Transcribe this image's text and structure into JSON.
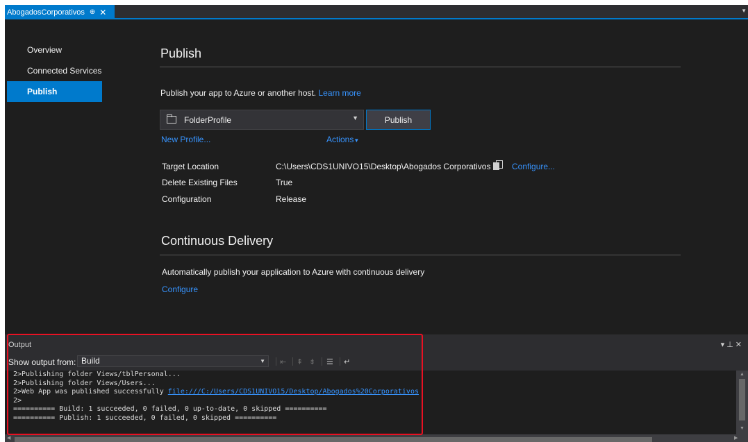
{
  "tab": {
    "title": "AbogadosCorporativos",
    "pin_glyph": "⊕",
    "close_glyph": "✕"
  },
  "nav": {
    "items": [
      {
        "label": "Overview"
      },
      {
        "label": "Connected Services"
      },
      {
        "label": "Publish",
        "active": true
      }
    ]
  },
  "publish": {
    "title": "Publish",
    "intro_text": "Publish your app to Azure or another host.",
    "learn_more": "Learn more",
    "profile_selected": "FolderProfile",
    "publish_button": "Publish",
    "new_profile": "New Profile...",
    "actions": "Actions",
    "details": [
      {
        "key": "Target Location",
        "value": "C:\\Users\\CDS1UNIVO15\\Desktop\\Abogados Corporativos"
      },
      {
        "key": "Delete Existing Files",
        "value": "True"
      },
      {
        "key": "Configuration",
        "value": "Release"
      }
    ],
    "configure": "Configure..."
  },
  "continuous_delivery": {
    "title": "Continuous Delivery",
    "description": "Automatically publish your application to Azure with continuous delivery",
    "configure": "Configure"
  },
  "output": {
    "title": "Output",
    "show_from_label": "Show output from:",
    "source": "Build",
    "lines": [
      "2>Publishing folder Views/tblPersonal...",
      "2>Publishing folder Views/Users...",
      "2>Web App was published successfully ",
      "2>",
      "========== Build: 1 succeeded, 0 failed, 0 up-to-date, 0 skipped ==========",
      "========== Publish: 1 succeeded, 0 failed, 0 skipped =========="
    ],
    "published_url": "file:///C:/Users/CDS1UNIVO15/Desktop/Abogados%20Corporativos"
  },
  "colors": {
    "accent": "#007acc",
    "link": "#3794ff",
    "highlight": "#e81123",
    "background": "#1e1e1e"
  },
  "icons": [
    "folder-icon",
    "chevron-down-icon",
    "copy-icon",
    "pin-icon",
    "close-icon",
    "clear-all-icon",
    "word-wrap-icon"
  ]
}
